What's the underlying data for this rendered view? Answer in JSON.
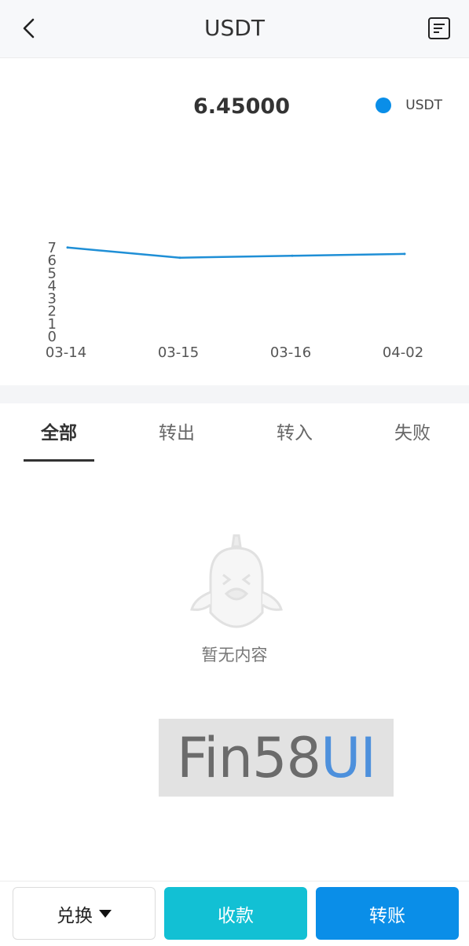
{
  "header": {
    "title": "USDT",
    "back_icon": "chevron-left-icon",
    "record_icon": "document-list-icon"
  },
  "summary": {
    "price": "6.45000",
    "legend_label": "USDT",
    "legend_color": "#0a8ee8"
  },
  "chart_data": {
    "type": "line",
    "categories": [
      "03-14",
      "03-15",
      "03-16",
      "04-02"
    ],
    "series": [
      {
        "name": "USDT",
        "values": [
          6.95,
          6.15,
          6.3,
          6.45
        ],
        "color": "#1f8fd6"
      }
    ],
    "y_ticks": [
      "0",
      "1",
      "2",
      "3",
      "4",
      "5",
      "6",
      "7"
    ],
    "ylim": [
      0,
      7
    ],
    "grid": false,
    "legend_position": "top-right"
  },
  "tabs": [
    {
      "label": "全部",
      "active": true
    },
    {
      "label": "转出",
      "active": false
    },
    {
      "label": "转入",
      "active": false
    },
    {
      "label": "失败",
      "active": false
    }
  ],
  "empty_state": {
    "text": "暂无内容",
    "icon": "empty-mascot-icon"
  },
  "watermark": {
    "part1": "Fin58",
    "part2": "UI"
  },
  "actions": {
    "exchange_label": "兑换",
    "receive_label": "收款",
    "transfer_label": "转账",
    "receive_color": "#12c0d4",
    "transfer_color": "#0a8ee8"
  }
}
